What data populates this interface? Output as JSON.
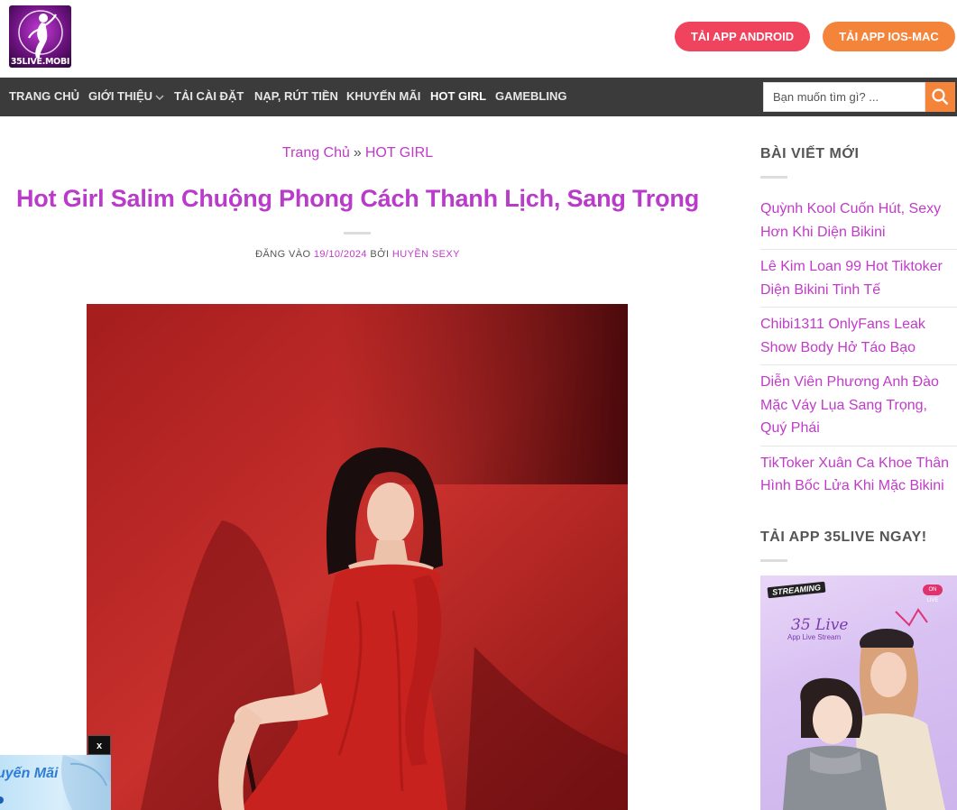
{
  "header": {
    "logo_text": "35LIVE.MOBI",
    "android_button": "TẢI APP ANDROID",
    "ios_button": "TẢI APP IOS-MAC"
  },
  "nav": {
    "items": [
      {
        "label": "TRANG CHỦ"
      },
      {
        "label": "GIỚI THIỆU"
      },
      {
        "label": "TẢI CÀI ĐẶT"
      },
      {
        "label": "NẠP, RÚT TIỀN"
      },
      {
        "label": "KHUYẾN MÃI"
      },
      {
        "label": "HOT GIRL"
      },
      {
        "label": "GAMEBLING"
      }
    ],
    "search_placeholder": "Bạn muốn tìm gì? ..."
  },
  "breadcrumb": {
    "home": "Trang Chủ",
    "separator": "»",
    "current": "HOT GIRL"
  },
  "post": {
    "title": "Hot Girl Salim Chuộng Phong Cách Thanh Lịch, Sang Trọng",
    "meta_prefix": "ĐĂNG VÀO",
    "date": "19/10/2024",
    "by": "BỞI",
    "author": "HUYỀN SEXY"
  },
  "promo": {
    "text": "uyến Mãi",
    "close": "x"
  },
  "sidebar": {
    "recent_title": "BÀI VIẾT MỚI",
    "recent_posts": [
      "Quỳnh Kool Cuốn Hút, Sexy Hơn Khi Diện Bikini",
      "Lê Kim Loan 99 Hot Tiktoker Diện Bikini Tinh Tế",
      "Chibi1311 OnlyFans Leak Show Body Hở Táo Bạo",
      "Diễn Viên Phương Anh Đào Mặc Váy Lụa Sang Trọng, Quý Phái",
      "TikToker Xuân Ca Khoe Thân Hình Bốc Lửa Khi Mặc Bikini"
    ],
    "app_title": "TẢI APP 35LIVE NGAY!",
    "banner": {
      "badge": "STREAMING",
      "logo": "35 Live",
      "subtitle": "App Live Stream",
      "live_tag": "ON LIVE"
    }
  },
  "colors": {
    "accent": "#c13bc9",
    "android": "#f0435e",
    "ios": "#f5843b",
    "nav_bg": "#3b3b3b"
  }
}
